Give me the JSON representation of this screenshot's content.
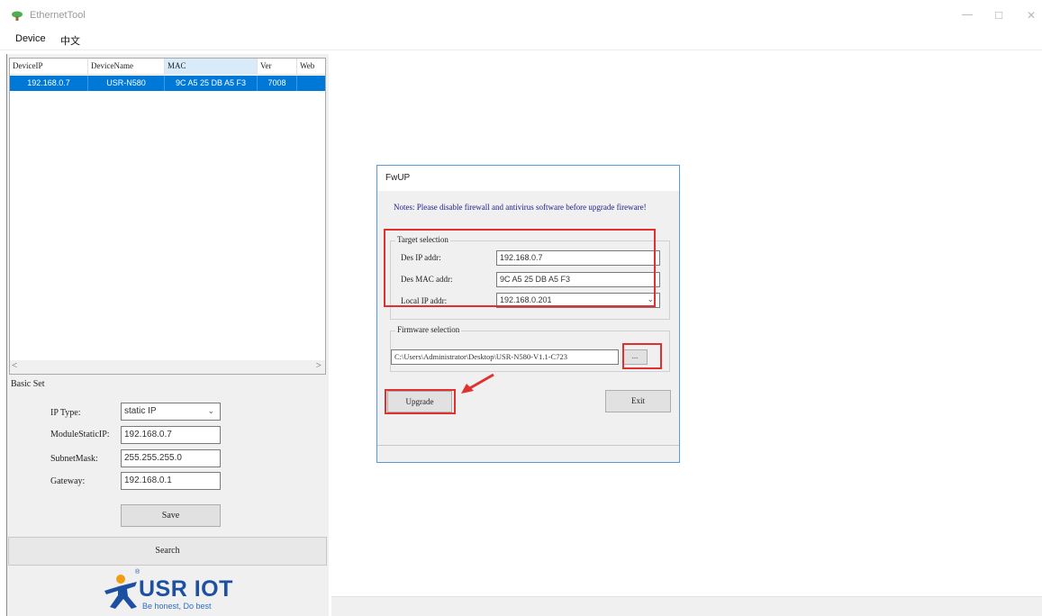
{
  "window": {
    "title": "EthernetTool",
    "controls": {
      "minimize": "—",
      "maximize": "☐",
      "close": "✕"
    }
  },
  "menu": {
    "device": "Device",
    "language": "中文"
  },
  "device_list": {
    "columns": [
      "DeviceIP",
      "DeviceName",
      "MAC",
      "Ver",
      "Web"
    ],
    "rows": [
      [
        "192.168.0.7",
        "USR-N580",
        "9C A5 25 DB A5 F3",
        "7008",
        ""
      ]
    ],
    "scroll_left": "<",
    "scroll_right": ">"
  },
  "basic_set": {
    "title": "Basic Set",
    "ip_type_label": "IP Type:",
    "ip_type_value": "static IP",
    "module_ip_label": "ModuleStaticIP:",
    "module_ip_value": "192.168.0.7",
    "subnet_label": "SubnetMask:",
    "subnet_value": "255.255.255.0",
    "gateway_label": "Gateway:",
    "gateway_value": "192.168.0.1",
    "save_label": "Save",
    "search_label": "Search"
  },
  "logo": {
    "text": "USR IOT",
    "tagline": "Be honest, Do best",
    "registered": "®"
  },
  "dialog": {
    "title": "FwUP",
    "notes": "Notes: Please disable firewall and antivirus software before upgrade fireware!",
    "target_group": "Target selection",
    "des_ip_label": "Des IP addr:",
    "des_ip_value": "192.168.0.7",
    "des_mac_label": "Des MAC addr:",
    "des_mac_value": "9C A5 25 DB A5 F3",
    "local_ip_label": "Local IP addr:",
    "local_ip_value": "192.168.0.201",
    "firmware_group": "Firmware selection",
    "firmware_path": "C:\\Users\\Administrator\\Desktop\\USR-N580-V1.1-C723",
    "browse_label": "...",
    "upgrade_label": "Upgrade",
    "exit_label": "Exit"
  },
  "colors": {
    "selection": "#0078d7",
    "highlight": "#e0312e",
    "brand": "#1d4fa3",
    "dialog_border": "#5b9bd5"
  }
}
